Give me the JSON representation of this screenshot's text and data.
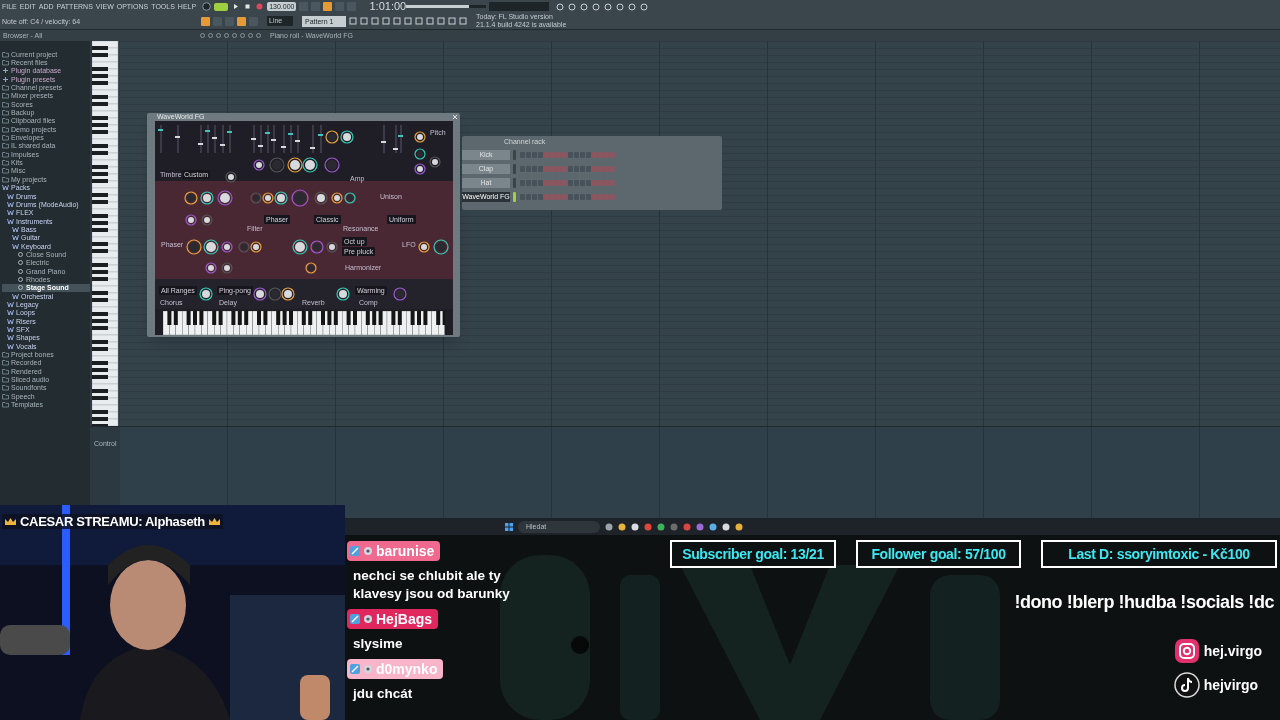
{
  "toolbar": {
    "pattern_mode_on": true,
    "master_volume": {
      "level": 0.78
    },
    "menu": [
      "FILE",
      "EDIT",
      "ADD",
      "PATTERNS",
      "VIEW",
      "OPTIONS",
      "TOOLS",
      "HELP"
    ],
    "tempo": "130.000",
    "time": "1:01:00",
    "status": "Note off: C4 / velocity: 64",
    "snap": "Line",
    "pattern": "Pattern 1",
    "hint": [
      "Today: FL Studio version",
      "21.1.4 build 4242 is available"
    ]
  },
  "browser": {
    "title": "Browser - All",
    "items": [
      {
        "label": "Current project",
        "kind": "folder",
        "selected": false
      },
      {
        "label": "Recent files",
        "kind": "folder",
        "selected": false
      },
      {
        "label": "Plugin database",
        "kind": "plugin",
        "selected": false
      },
      {
        "label": "Plugin presets",
        "kind": "plugin",
        "selected": false
      },
      {
        "label": "Channel presets",
        "kind": "folder",
        "selected": false
      },
      {
        "label": "Mixer presets",
        "kind": "folder",
        "selected": false
      },
      {
        "label": "Scores",
        "kind": "folder",
        "selected": false
      },
      {
        "label": "Backup",
        "kind": "folder",
        "selected": false
      },
      {
        "label": "Clipboard files",
        "kind": "folder",
        "selected": false
      },
      {
        "label": "Demo projects",
        "kind": "folder",
        "selected": false
      },
      {
        "label": "Envelopes",
        "kind": "folder",
        "selected": false
      },
      {
        "label": "IL shared data",
        "kind": "folder",
        "selected": false
      },
      {
        "label": "Impulses",
        "kind": "folder",
        "selected": false
      },
      {
        "label": "Kits",
        "kind": "folder",
        "selected": false
      },
      {
        "label": "Misc",
        "kind": "folder",
        "selected": false
      },
      {
        "label": "My projects",
        "kind": "folder",
        "selected": false
      },
      {
        "label": "Packs",
        "kind": "pack",
        "selected": false,
        "children": [
          {
            "label": "Drums",
            "kind": "pack",
            "selected": false
          },
          {
            "label": "Drums (ModeAudio)",
            "kind": "pack",
            "selected": false
          },
          {
            "label": "FLEX",
            "kind": "pack",
            "selected": false
          },
          {
            "label": "Instruments",
            "kind": "pack",
            "selected": false,
            "children": [
              {
                "label": "Bass",
                "kind": "pack",
                "selected": false
              },
              {
                "label": "Guitar",
                "kind": "pack",
                "selected": false
              },
              {
                "label": "Keyboard",
                "kind": "pack",
                "selected": false,
                "children": [
                  {
                    "label": "Close Sound",
                    "kind": "preset",
                    "selected": false
                  },
                  {
                    "label": "Electric",
                    "kind": "preset",
                    "selected": false
                  },
                  {
                    "label": "Grand Piano",
                    "kind": "preset",
                    "selected": false
                  },
                  {
                    "label": "Rhodes",
                    "kind": "preset",
                    "selected": false
                  },
                  {
                    "label": "Stage Sound",
                    "kind": "preset",
                    "selected": true
                  }
                ]
              },
              {
                "label": "Orchestral",
                "kind": "pack",
                "selected": false
              }
            ]
          },
          {
            "label": "Legacy",
            "kind": "pack",
            "selected": false
          },
          {
            "label": "Loops",
            "kind": "pack",
            "selected": false
          },
          {
            "label": "Risers",
            "kind": "pack",
            "selected": false
          },
          {
            "label": "SFX",
            "kind": "pack",
            "selected": false
          },
          {
            "label": "Shapes",
            "kind": "pack",
            "selected": false
          },
          {
            "label": "Vocals",
            "kind": "pack",
            "selected": false
          }
        ]
      },
      {
        "label": "Project bones",
        "kind": "folder",
        "selected": false
      },
      {
        "label": "Recorded",
        "kind": "folder",
        "selected": false
      },
      {
        "label": "Rendered",
        "kind": "folder",
        "selected": false
      },
      {
        "label": "Sliced audio",
        "kind": "folder",
        "selected": false
      },
      {
        "label": "Soundfonts",
        "kind": "folder",
        "selected": false
      },
      {
        "label": "Speech",
        "kind": "folder",
        "selected": false
      },
      {
        "label": "Templates",
        "kind": "folder",
        "selected": false
      }
    ]
  },
  "piano_roll": {
    "title": "Piano roll - WaveWorld FG",
    "control_label": "Control"
  },
  "plugin": {
    "title": "WaveWorld FG",
    "labels": [
      {
        "text": "Timbre",
        "kind": "section"
      },
      {
        "text": "Custom",
        "kind": "dropdown"
      },
      {
        "text": "Amp",
        "kind": "section"
      },
      {
        "text": "Pitch",
        "kind": "section"
      },
      {
        "text": "Unison",
        "kind": "section"
      },
      {
        "text": "Filter",
        "kind": "section"
      },
      {
        "text": "Resonance",
        "kind": "section"
      },
      {
        "text": "Phaser",
        "kind": "section"
      },
      {
        "text": "LFO",
        "kind": "section"
      },
      {
        "text": "Harmonizer",
        "kind": "section"
      },
      {
        "text": "Chorus",
        "kind": "section"
      },
      {
        "text": "Delay",
        "kind": "section"
      },
      {
        "text": "Reverb",
        "kind": "section"
      },
      {
        "text": "Comp",
        "kind": "section"
      },
      {
        "text": "Phaser",
        "kind": "dropdown"
      },
      {
        "text": "Classic",
        "kind": "dropdown"
      },
      {
        "text": "Uniform",
        "kind": "dropdown"
      },
      {
        "text": "Oct up",
        "kind": "dropdown"
      },
      {
        "text": "Pre pluck",
        "kind": "dropdown"
      },
      {
        "text": "All Ranges",
        "kind": "dropdown"
      },
      {
        "text": "Ping-pong",
        "kind": "dropdown"
      },
      {
        "text": "Warming",
        "kind": "dropdown"
      }
    ]
  },
  "channel_rack": {
    "title": "Channel rack",
    "channels": [
      {
        "name": "Kick",
        "selected": false
      },
      {
        "name": "Clap",
        "selected": false
      },
      {
        "name": "Hat",
        "selected": false
      },
      {
        "name": "WaveWorld FG",
        "selected": true
      }
    ]
  },
  "taskbar": {
    "search_placeholder": "Hledat"
  },
  "overlay": {
    "top_donor": "CAESAR STREAMU: Alphaseth",
    "chat": [
      {
        "user": "barunise",
        "color": "#f06a8f",
        "message": "nechci se chlubit ale ty klavesy jsou od barunky"
      },
      {
        "user": "HejBags",
        "color": "#e0285f",
        "message": "slysime"
      },
      {
        "user": "d0mynko",
        "color": "#f8b4c8",
        "message": "jdu chcát"
      }
    ],
    "goals": [
      "Subscriber goal: 13/21",
      "Follower goal: 57/100",
      "Last D: ssoryimtoxic - Kč100"
    ],
    "commands": "!dono !blerp !hudba !socials !dc",
    "socials": [
      {
        "kind": "instagram",
        "handle": "hej.virgo"
      },
      {
        "kind": "tiktok",
        "handle": "hejvirgo"
      }
    ]
  }
}
